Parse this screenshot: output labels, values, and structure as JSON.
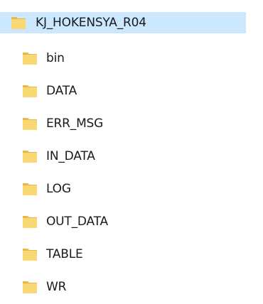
{
  "tree": {
    "root": {
      "label": "KJ_HOKENSYA_R04",
      "icon": "folder-icon",
      "selected": true
    },
    "children": [
      {
        "label": "bin",
        "icon": "folder-icon"
      },
      {
        "label": "DATA",
        "icon": "folder-icon"
      },
      {
        "label": "ERR_MSG",
        "icon": "folder-icon"
      },
      {
        "label": "IN_DATA",
        "icon": "folder-icon"
      },
      {
        "label": "LOG",
        "icon": "folder-icon"
      },
      {
        "label": "OUT_DATA",
        "icon": "folder-icon"
      },
      {
        "label": "TABLE",
        "icon": "folder-icon"
      },
      {
        "label": "WR",
        "icon": "folder-icon"
      }
    ]
  },
  "colors": {
    "selection": "#cce8ff",
    "folder_body": "#f8d775",
    "folder_back": "#e8b84a"
  }
}
